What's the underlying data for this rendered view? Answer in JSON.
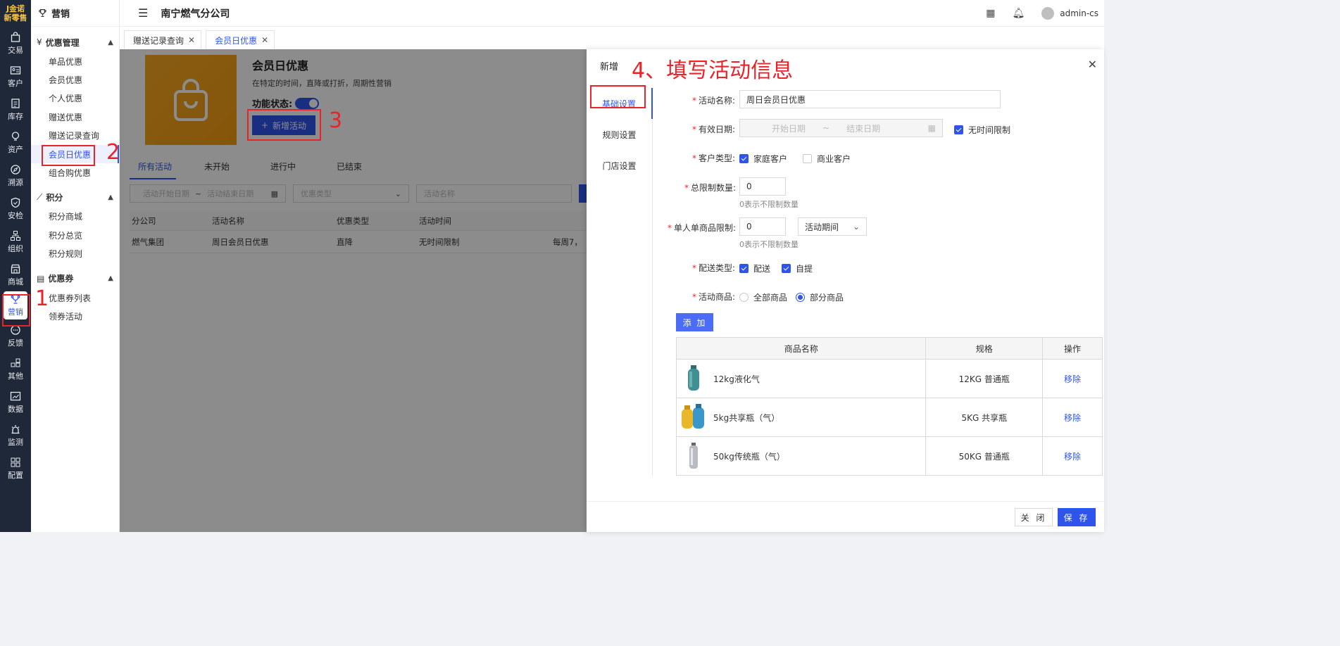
{
  "brand": {
    "line1": "J金诺",
    "line2": "新零售"
  },
  "rail": [
    {
      "label": "交易",
      "icon": "bag-icon"
    },
    {
      "label": "客户",
      "icon": "id-card-icon"
    },
    {
      "label": "库存",
      "icon": "clipboard-icon"
    },
    {
      "label": "资产",
      "icon": "bulb-icon"
    },
    {
      "label": "溯源",
      "icon": "compass-icon"
    },
    {
      "label": "安检",
      "icon": "shield-icon"
    },
    {
      "label": "组织",
      "icon": "org-icon"
    },
    {
      "label": "商城",
      "icon": "store-icon"
    },
    {
      "label": "营销",
      "icon": "trophy-icon"
    },
    {
      "label": "反馈",
      "icon": "chat-icon"
    },
    {
      "label": "其他",
      "icon": "blocks-icon"
    },
    {
      "label": "数据",
      "icon": "chart-icon"
    },
    {
      "label": "监测",
      "icon": "alarm-icon"
    },
    {
      "label": "配置",
      "icon": "grid-icon"
    }
  ],
  "sidebar": {
    "title": "营销",
    "groups": [
      {
        "title": "优惠管理",
        "items": [
          "单品优惠",
          "会员优惠",
          "个人优惠",
          "赠送优惠",
          "赠送记录查询",
          "会员日优惠",
          "组合购优惠"
        ]
      },
      {
        "title": "积分",
        "items": [
          "积分商城",
          "积分总览",
          "积分规则"
        ]
      },
      {
        "title": "优惠券",
        "items": [
          "优惠券列表",
          "领券活动"
        ]
      }
    ]
  },
  "header": {
    "title": "南宁燃气分公司",
    "user": "admin-cs"
  },
  "tabs": [
    {
      "label": "赠送记录查询"
    },
    {
      "label": "会员日优惠"
    }
  ],
  "main": {
    "title": "会员日优惠",
    "desc": "在特定的时间，直降或打折，周期性营销",
    "status_label": "功能状态:",
    "new_button": "新增活动",
    "tabs": [
      "所有活动",
      "未开始",
      "进行中",
      "已结束"
    ],
    "filters": {
      "start": "活动开始日期",
      "sep": "~",
      "end": "活动结束日期",
      "type": "优惠类型",
      "name": "活动名称"
    },
    "columns": [
      "分公司",
      "活动名称",
      "优惠类型",
      "活动时间"
    ],
    "rows": [
      {
        "c1": "燃气集团",
        "c2": "周日会员日优惠",
        "c3": "直降",
        "c4": "无时间限制",
        "c5": "每周7，"
      }
    ]
  },
  "drawer": {
    "title": "新增",
    "nav": [
      "基础设置",
      "规则设置",
      "门店设置"
    ],
    "form": {
      "name_label": "活动名称:",
      "name_value": "周日会员日优惠",
      "date_label": "有效日期:",
      "date_start": "开始日期",
      "date_sep": "~",
      "date_end": "结束日期",
      "no_limit": "无时间限制",
      "ctype_label": "客户类型:",
      "ctype_home": "家庭客户",
      "ctype_biz": "商业客户",
      "total_label": "总限制数量:",
      "total_value": "0",
      "total_hint": "0表示不限制数量",
      "single_label": "单人单商品限制:",
      "single_value": "0",
      "single_period": "活动期间",
      "single_hint": "0表示不限制数量",
      "delivery_label": "配送类型:",
      "delivery_1": "配送",
      "delivery_2": "自提",
      "goods_label": "活动商品:",
      "goods_all": "全部商品",
      "goods_part": "部分商品",
      "add_button": "添 加"
    },
    "table": {
      "columns": [
        "商品名称",
        "规格",
        "操作"
      ],
      "rows": [
        {
          "name": "12kg液化气",
          "spec": "12KG 普通瓶",
          "action": "移除"
        },
        {
          "name": "5kg共享瓶（气）",
          "spec": "5KG 共享瓶",
          "action": "移除"
        },
        {
          "name": "50kg传统瓶（气）",
          "spec": "50KG 普通瓶",
          "action": "移除"
        }
      ]
    },
    "close_button": "关 闭",
    "save_button": "保 存"
  },
  "annotations": {
    "n1": "1",
    "n2": "2",
    "n3": "3",
    "title": "4、填写活动信息"
  },
  "colors": {
    "accent": "#2f54eb",
    "annotation": "#e8232a",
    "rail": "#1f2838"
  }
}
